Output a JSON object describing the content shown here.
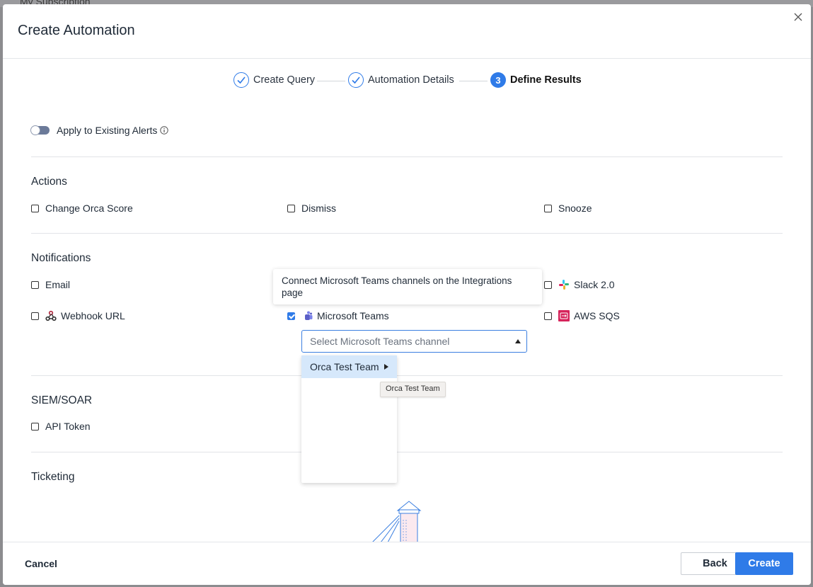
{
  "background": {
    "partial_text": "My Subscription"
  },
  "modal": {
    "title": "Create Automation"
  },
  "stepper": {
    "steps": [
      {
        "label": "Create Query",
        "state": "done"
      },
      {
        "label": "Automation Details",
        "state": "done"
      },
      {
        "label": "Define Results",
        "state": "active",
        "number": "3"
      }
    ]
  },
  "apply_existing": {
    "label": "Apply to Existing Alerts",
    "enabled": false
  },
  "actions": {
    "title": "Actions",
    "items": [
      {
        "label": "Change Orca Score",
        "checked": false
      },
      {
        "label": "Dismiss",
        "checked": false
      },
      {
        "label": "Snooze",
        "checked": false
      }
    ]
  },
  "notifications": {
    "title": "Notifications",
    "items": [
      {
        "label": "Email",
        "checked": false
      },
      {
        "label": "Slack 2.0",
        "checked": false,
        "icon": "slack-icon"
      },
      {
        "label": "Webhook URL",
        "checked": false,
        "icon": "webhook-icon"
      },
      {
        "label": "Microsoft Teams",
        "checked": true,
        "icon": "teams-icon"
      },
      {
        "label": "AWS SQS",
        "checked": false,
        "icon": "aws-sqs-icon"
      }
    ],
    "teams_tooltip": "Connect Microsoft Teams channels on the Integrations page",
    "teams_select": {
      "placeholder": "Select Microsoft Teams channel",
      "options": [
        {
          "label": "Orca Test Team",
          "has_submenu": true
        }
      ],
      "hover_tip": "Orca Test Team"
    }
  },
  "siem": {
    "title": "SIEM/SOAR",
    "items": [
      {
        "label": "API Token",
        "checked": false
      }
    ]
  },
  "ticketing": {
    "title": "Ticketing"
  },
  "footer": {
    "cancel": "Cancel",
    "back": "Back",
    "create": "Create"
  },
  "colors": {
    "accent": "#2f7be8",
    "slack": "#e01e5a",
    "teams": "#5b5fc7",
    "aws_sqs": "#d6245b"
  }
}
